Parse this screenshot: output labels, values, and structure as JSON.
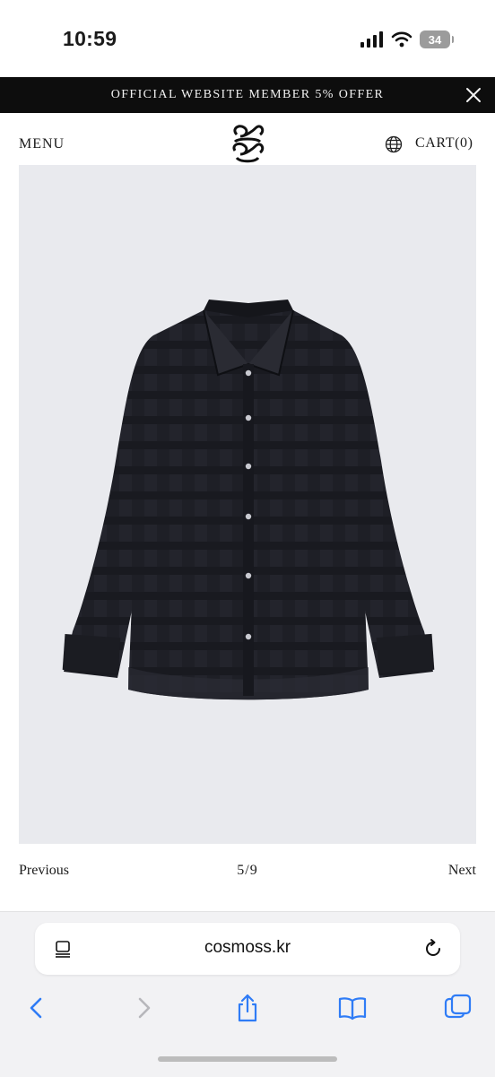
{
  "status_bar": {
    "time": "10:59",
    "battery": "34"
  },
  "promo": {
    "text": "OFFICIAL WEBSITE MEMBER 5% OFFER"
  },
  "header": {
    "menu_label": "MENU",
    "cart_label": "CART(0)"
  },
  "gallery": {
    "prev_label": "Previous",
    "counter": "5/9",
    "next_label": "Next"
  },
  "browser": {
    "url": "cosmoss.kr"
  },
  "colors": {
    "banner_bg": "#0d0d0d",
    "image_bg": "#e9eaee",
    "accent_blue": "#2f7cf6"
  }
}
